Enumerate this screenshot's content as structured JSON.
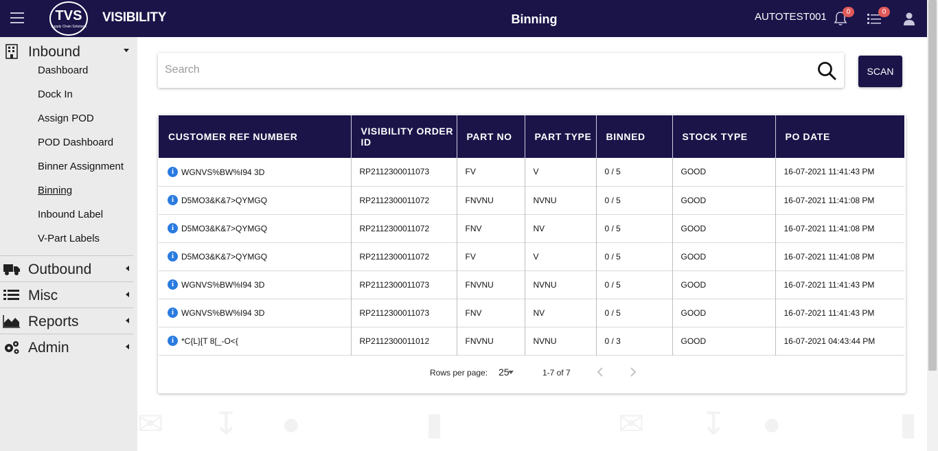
{
  "header": {
    "logo_text": "TVS",
    "logo_sub": "Supply Chain Solutions",
    "brand": "VISIBILITY",
    "title": "Binning",
    "username": "AUTOTEST001",
    "notifications_count": "0",
    "tasks_count": "0"
  },
  "sidebar": {
    "inbound": {
      "label": "Inbound",
      "items": [
        "Dashboard",
        "Dock In",
        "Assign POD",
        "POD Dashboard",
        "Binner Assignment",
        "Binning",
        "Inbound Label",
        "V-Part Labels"
      ],
      "active": "Binning"
    },
    "outbound": {
      "label": "Outbound"
    },
    "misc": {
      "label": "Misc"
    },
    "reports": {
      "label": "Reports"
    },
    "admin": {
      "label": "Admin"
    }
  },
  "search": {
    "placeholder": "Search",
    "value": ""
  },
  "scan_button": "SCAN",
  "table": {
    "headers": {
      "customer_ref": "CUSTOMER REF NUMBER",
      "visibility_order": "VISIBILITY ORDER ID",
      "part_no": "PART NO",
      "part_type": "PART TYPE",
      "binned": "BINNED",
      "stock_type": "STOCK TYPE",
      "po_date": "PO DATE"
    },
    "rows": [
      {
        "ref": "WGNVS%BW%I94 3D",
        "order": "RP2112300011073",
        "part_no": "FV",
        "part_type": "V",
        "binned": "0 / 5",
        "stock": "GOOD",
        "po_date": "16-07-2021 11:41:43 PM"
      },
      {
        "ref": "D5MO3&K&7>QYMGQ",
        "order": "RP2112300011072",
        "part_no": "FNVNU",
        "part_type": "NVNU",
        "binned": "0 / 5",
        "stock": "GOOD",
        "po_date": "16-07-2021 11:41:08 PM"
      },
      {
        "ref": "D5MO3&K&7>QYMGQ",
        "order": "RP2112300011072",
        "part_no": "FNV",
        "part_type": "NV",
        "binned": "0 / 5",
        "stock": "GOOD",
        "po_date": "16-07-2021 11:41:08 PM"
      },
      {
        "ref": "D5MO3&K&7>QYMGQ",
        "order": "RP2112300011072",
        "part_no": "FV",
        "part_type": "V",
        "binned": "0 / 5",
        "stock": "GOOD",
        "po_date": "16-07-2021 11:41:08 PM"
      },
      {
        "ref": "WGNVS%BW%I94 3D",
        "order": "RP2112300011073",
        "part_no": "FNVNU",
        "part_type": "NVNU",
        "binned": "0 / 5",
        "stock": "GOOD",
        "po_date": "16-07-2021 11:41:43 PM"
      },
      {
        "ref": "WGNVS%BW%I94 3D",
        "order": "RP2112300011073",
        "part_no": "FNV",
        "part_type": "NV",
        "binned": "0 / 5",
        "stock": "GOOD",
        "po_date": "16-07-2021 11:41:43 PM"
      },
      {
        "ref": "*C{L}[T 8[_-O<{",
        "order": "RP2112300011012",
        "part_no": "FNVNU",
        "part_type": "NVNU",
        "binned": "0 / 3",
        "stock": "GOOD",
        "po_date": "16-07-2021 04:43:44 PM"
      }
    ]
  },
  "pagination": {
    "rows_per_page_label": "Rows per page:",
    "rows_per_page": "25",
    "range": "1-7 of 7"
  },
  "colors": {
    "primary": "#1a1449",
    "info": "#2a7be0",
    "badge": "#e05a5a",
    "sidebar_bg": "#ebebeb"
  }
}
